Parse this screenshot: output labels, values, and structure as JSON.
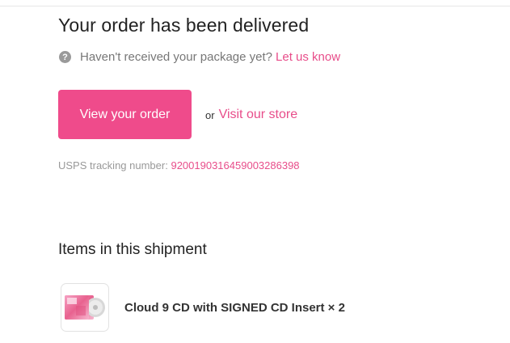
{
  "header": {
    "title": "Your order has been delivered"
  },
  "help": {
    "icon": "question-circle-icon",
    "text": "Haven't received your package yet?",
    "link_label": "Let us know"
  },
  "actions": {
    "view_order_label": "View your order",
    "or_text": "or",
    "visit_store_label": "Visit our store"
  },
  "tracking": {
    "label": "USPS tracking number:",
    "number": "9200190316459003286398"
  },
  "shipment": {
    "title": "Items in this shipment",
    "items": [
      {
        "name": "Cloud 9 CD with SIGNED CD Insert × 2",
        "thumbnail_icon": "cd-product-thumbnail"
      }
    ]
  },
  "colors": {
    "accent": "#ef4b8b",
    "link": "#e84d8a",
    "text": "#222222",
    "muted": "#777777"
  }
}
